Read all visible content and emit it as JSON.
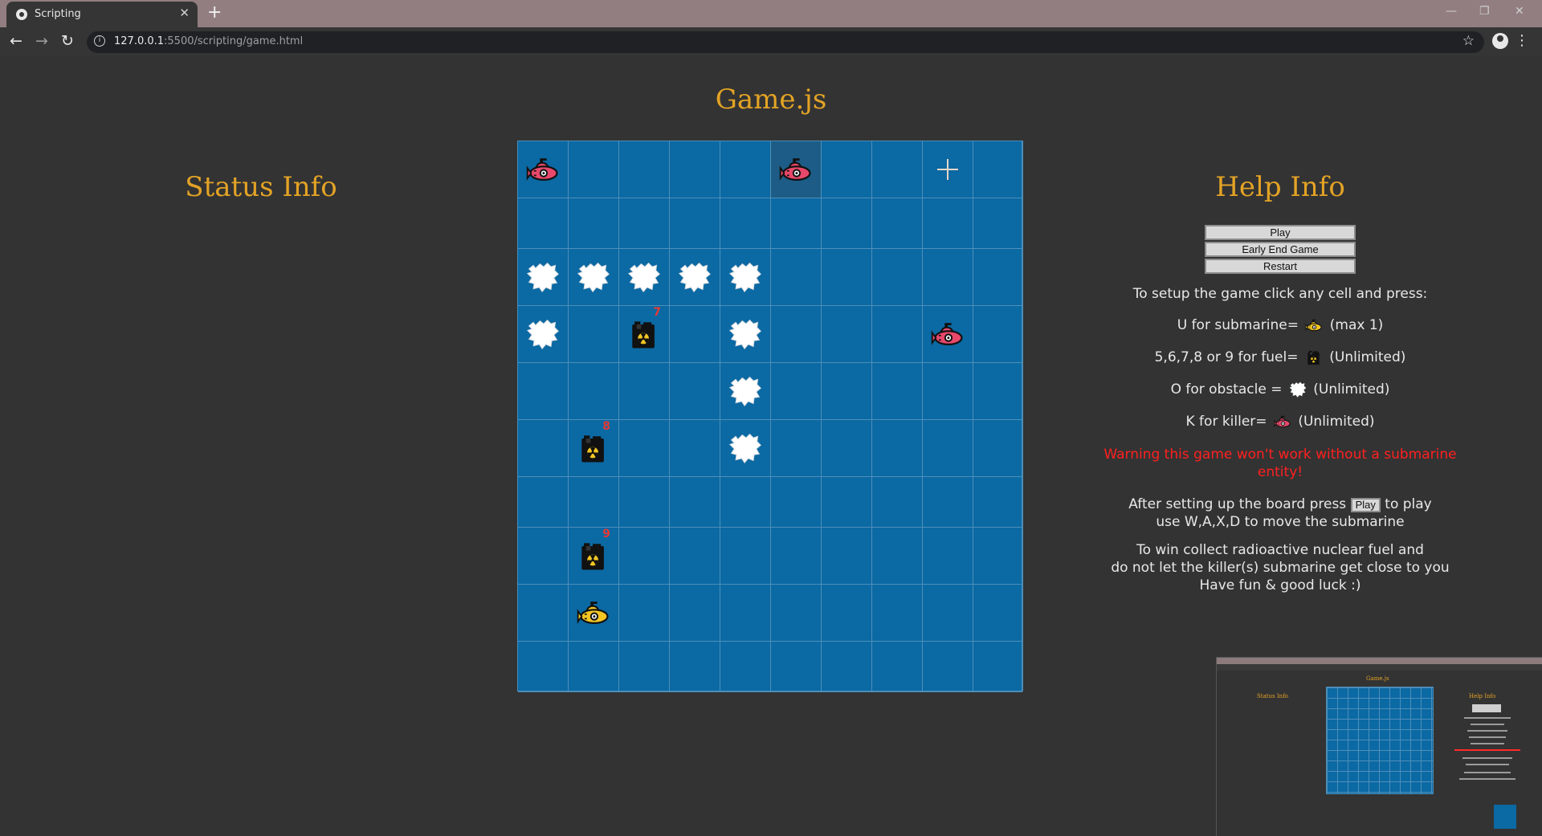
{
  "browser": {
    "tab_title": "Scripting",
    "url_host": "127.0.0.1",
    "url_rest": ":5500/scripting/game.html"
  },
  "page": {
    "title": "Game.js",
    "status_title": "Status Info",
    "help_title": "Help Info"
  },
  "buttons": {
    "play": "Play",
    "early_end": "Early End Game",
    "restart": "Restart"
  },
  "help": {
    "setup": "To setup the game click any cell and press:",
    "submarine_prefix": "U for submarine=",
    "submarine_suffix": "(max 1)",
    "fuel_prefix": "5,6,7,8 or 9 for fuel=",
    "fuel_suffix": "(Unlimited)",
    "obstacle_prefix": "O for obstacle =",
    "obstacle_suffix": "(Unlimited)",
    "killer_prefix": "K for killer=",
    "killer_suffix": "(Unlimited)",
    "warning": "Warning this game won't work without a submarine entity!",
    "after_prefix": "After setting up the board press",
    "after_btn": "Play",
    "after_suffix": "to play",
    "move": "use W,A,X,D to move the submarine",
    "win1": "To win collect radioactive nuclear fuel and",
    "win2": "do not let the killer(s) submarine get close to you",
    "win3": "Have fun & good luck :)"
  },
  "board": {
    "cols": 10,
    "rows": 10,
    "entities": [
      {
        "row": 0,
        "col": 0,
        "type": "killer"
      },
      {
        "row": 0,
        "col": 5,
        "type": "killer",
        "highlight": true
      },
      {
        "row": 0,
        "col": 8,
        "type": "cursor"
      },
      {
        "row": 2,
        "col": 0,
        "type": "obstacle"
      },
      {
        "row": 2,
        "col": 1,
        "type": "obstacle"
      },
      {
        "row": 2,
        "col": 2,
        "type": "obstacle"
      },
      {
        "row": 2,
        "col": 3,
        "type": "obstacle"
      },
      {
        "row": 2,
        "col": 4,
        "type": "obstacle"
      },
      {
        "row": 3,
        "col": 0,
        "type": "obstacle"
      },
      {
        "row": 3,
        "col": 2,
        "type": "fuel",
        "value": "7"
      },
      {
        "row": 3,
        "col": 4,
        "type": "obstacle"
      },
      {
        "row": 3,
        "col": 8,
        "type": "killer"
      },
      {
        "row": 4,
        "col": 4,
        "type": "obstacle"
      },
      {
        "row": 5,
        "col": 1,
        "type": "fuel",
        "value": "8"
      },
      {
        "row": 5,
        "col": 4,
        "type": "obstacle"
      },
      {
        "row": 7,
        "col": 1,
        "type": "fuel",
        "value": "9"
      },
      {
        "row": 8,
        "col": 1,
        "type": "submarine"
      }
    ]
  },
  "colors": {
    "accent": "#e3a325",
    "board": "#0b69a3",
    "warning": "#ff2020",
    "killer": "#e8486b",
    "submarine": "#f3c623"
  },
  "thumbnail": {
    "title": "Game.js",
    "status": "Status Info",
    "help": "Help Info"
  }
}
